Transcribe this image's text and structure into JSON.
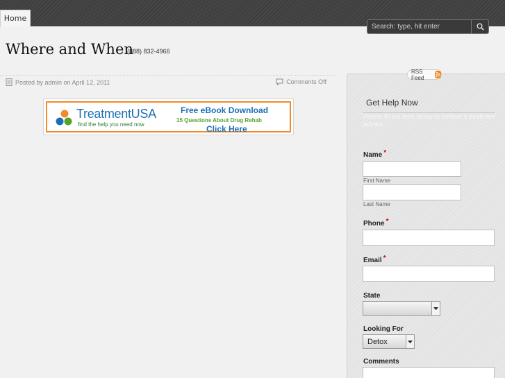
{
  "nav": {
    "home_label": "Home"
  },
  "search": {
    "placeholder": "Search: type, hit enter",
    "button_icon": "search-icon"
  },
  "header": {
    "site_title": "Where and When",
    "phone": "(888) 832-4966"
  },
  "post": {
    "meta_left": "Posted by admin on April 12, 2011",
    "meta_right": "Comments Off"
  },
  "banner": {
    "brand": "TreatmentUSA",
    "tagline": "find the help you need now",
    "line1": "Free eBook Download",
    "line2": "15 Questions About Drug Rehab",
    "line3": "Click Here"
  },
  "sidebar": {
    "rss_label": "RSS Feed",
    "widget_title": "Get Help Now",
    "widget_intro": "Please fill out form below to contact a treatment advisor",
    "form": {
      "name_label": "Name",
      "first_name_label": "First Name",
      "last_name_label": "Last Name",
      "phone_label": "Phone",
      "email_label": "Email",
      "state_label": "State",
      "state_value": "",
      "looking_for_label": "Looking For",
      "looking_for_value": "Detox",
      "comments_label": "Comments",
      "required_mark": "*"
    }
  },
  "colors": {
    "topbar": "#444444",
    "banner_border": "#f08a2c",
    "brand_blue": "#1d6fb5",
    "brand_green": "#57a12b",
    "required": "#cc0000",
    "rss": "#f08a1c"
  }
}
